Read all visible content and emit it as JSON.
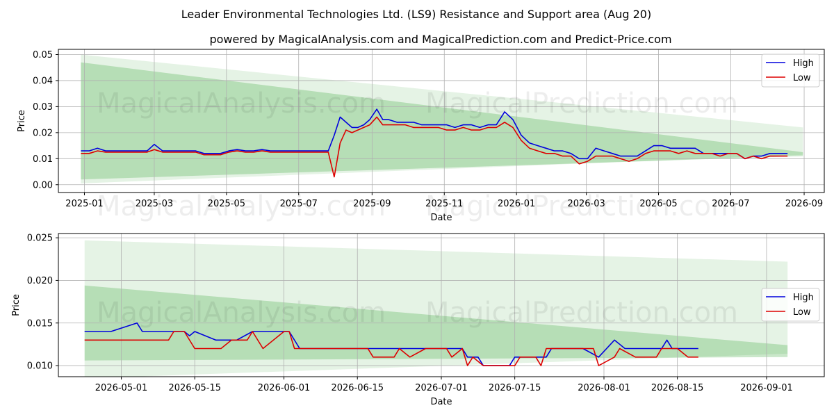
{
  "title": "Leader Environmental Technologies Ltd. (LS9) Resistance and Support area (Aug 20)",
  "subtitle": "powered by MagicalAnalysis.com and MagicalPrediction.com and Predict-Price.com",
  "watermarks": [
    "MagicalAnalysis.com",
    "MagicalPrediction.com"
  ],
  "colors": {
    "high": "#0000dd",
    "low": "#dd0000",
    "band": "#2ca02c"
  },
  "chart_data": [
    {
      "type": "line",
      "xlabel": "Date",
      "ylabel": "Price",
      "x_range": [
        "2024-12-10",
        "2026-09-18"
      ],
      "ylim": [
        -0.003,
        0.052
      ],
      "x_ticks": [
        "2025-01",
        "2025-03",
        "2025-05",
        "2025-07",
        "2025-09",
        "2025-11",
        "2026-01",
        "2026-03",
        "2026-05",
        "2026-07",
        "2026-09"
      ],
      "x_tick_dates": [
        "2025-01-01",
        "2025-03-01",
        "2025-05-01",
        "2025-07-01",
        "2025-09-01",
        "2025-11-01",
        "2026-01-01",
        "2026-03-01",
        "2026-05-01",
        "2026-07-01",
        "2026-09-01"
      ],
      "y_ticks": [
        "0.00",
        "0.01",
        "0.02",
        "0.03",
        "0.04",
        "0.05"
      ],
      "y_tick_values": [
        0,
        0.01,
        0.02,
        0.03,
        0.04,
        0.05
      ],
      "grid": true,
      "legend_position": "top-right",
      "bands": [
        {
          "x": [
            "2024-12-29",
            "2026-08-31"
          ],
          "upper": [
            0.05,
            0.022
          ],
          "lower": [
            0.0005,
            0.0115
          ]
        },
        {
          "x": [
            "2024-12-29",
            "2026-08-31"
          ],
          "upper": [
            0.047,
            0.0125
          ],
          "lower": [
            0.002,
            0.011
          ]
        }
      ],
      "series": [
        {
          "name": "High",
          "x": [
            "2024-12-29",
            "2025-01-05",
            "2025-01-12",
            "2025-01-19",
            "2025-01-26",
            "2025-02-02",
            "2025-02-09",
            "2025-02-16",
            "2025-02-23",
            "2025-03-01",
            "2025-03-08",
            "2025-03-15",
            "2025-03-22",
            "2025-03-29",
            "2025-04-05",
            "2025-04-12",
            "2025-04-19",
            "2025-04-26",
            "2025-05-03",
            "2025-05-10",
            "2025-05-17",
            "2025-05-24",
            "2025-05-31",
            "2025-06-07",
            "2025-06-14",
            "2025-06-21",
            "2025-06-28",
            "2025-07-05",
            "2025-07-12",
            "2025-07-19",
            "2025-07-26",
            "2025-07-31",
            "2025-08-05",
            "2025-08-10",
            "2025-08-15",
            "2025-08-20",
            "2025-08-25",
            "2025-08-30",
            "2025-09-05",
            "2025-09-10",
            "2025-09-15",
            "2025-09-22",
            "2025-09-29",
            "2025-10-06",
            "2025-10-13",
            "2025-10-20",
            "2025-10-27",
            "2025-11-03",
            "2025-11-10",
            "2025-11-17",
            "2025-11-24",
            "2025-12-01",
            "2025-12-08",
            "2025-12-15",
            "2025-12-22",
            "2025-12-29",
            "2026-01-05",
            "2026-01-12",
            "2026-01-19",
            "2026-01-26",
            "2026-02-02",
            "2026-02-09",
            "2026-02-16",
            "2026-02-23",
            "2026-03-02",
            "2026-03-09",
            "2026-03-16",
            "2026-03-23",
            "2026-03-30",
            "2026-04-06",
            "2026-04-13",
            "2026-04-20",
            "2026-04-27",
            "2026-05-04",
            "2026-05-11",
            "2026-05-18",
            "2026-05-25",
            "2026-06-01",
            "2026-06-08",
            "2026-06-15",
            "2026-06-22",
            "2026-06-29",
            "2026-07-06",
            "2026-07-13",
            "2026-07-20",
            "2026-07-27",
            "2026-08-03",
            "2026-08-10",
            "2026-08-18"
          ],
          "values": [
            0.013,
            0.013,
            0.014,
            0.013,
            0.013,
            0.013,
            0.013,
            0.013,
            0.013,
            0.0155,
            0.013,
            0.013,
            0.013,
            0.013,
            0.013,
            0.012,
            0.012,
            0.012,
            0.013,
            0.0135,
            0.013,
            0.013,
            0.0135,
            0.013,
            0.013,
            0.013,
            0.013,
            0.013,
            0.013,
            0.013,
            0.013,
            0.019,
            0.026,
            0.024,
            0.022,
            0.022,
            0.023,
            0.025,
            0.029,
            0.025,
            0.025,
            0.024,
            0.024,
            0.024,
            0.023,
            0.023,
            0.023,
            0.023,
            0.022,
            0.023,
            0.023,
            0.022,
            0.023,
            0.023,
            0.028,
            0.025,
            0.019,
            0.016,
            0.015,
            0.014,
            0.013,
            0.013,
            0.012,
            0.01,
            0.01,
            0.014,
            0.013,
            0.012,
            0.011,
            0.011,
            0.011,
            0.013,
            0.015,
            0.015,
            0.014,
            0.014,
            0.014,
            0.014,
            0.012,
            0.012,
            0.012,
            0.012,
            0.012,
            0.01,
            0.011,
            0.011,
            0.012,
            0.012,
            0.012
          ]
        },
        {
          "name": "Low",
          "x": [
            "2024-12-29",
            "2025-01-05",
            "2025-01-12",
            "2025-01-19",
            "2025-01-26",
            "2025-02-02",
            "2025-02-09",
            "2025-02-16",
            "2025-02-23",
            "2025-03-01",
            "2025-03-08",
            "2025-03-15",
            "2025-03-22",
            "2025-03-29",
            "2025-04-05",
            "2025-04-12",
            "2025-04-19",
            "2025-04-26",
            "2025-05-03",
            "2025-05-10",
            "2025-05-17",
            "2025-05-24",
            "2025-05-31",
            "2025-06-07",
            "2025-06-14",
            "2025-06-21",
            "2025-06-28",
            "2025-07-05",
            "2025-07-12",
            "2025-07-19",
            "2025-07-26",
            "2025-07-31",
            "2025-08-05",
            "2025-08-10",
            "2025-08-15",
            "2025-08-20",
            "2025-08-25",
            "2025-08-30",
            "2025-09-05",
            "2025-09-10",
            "2025-09-15",
            "2025-09-22",
            "2025-09-29",
            "2025-10-06",
            "2025-10-13",
            "2025-10-20",
            "2025-10-27",
            "2025-11-03",
            "2025-11-10",
            "2025-11-17",
            "2025-11-24",
            "2025-12-01",
            "2025-12-08",
            "2025-12-15",
            "2025-12-22",
            "2025-12-29",
            "2026-01-05",
            "2026-01-12",
            "2026-01-19",
            "2026-01-26",
            "2026-02-02",
            "2026-02-09",
            "2026-02-16",
            "2026-02-23",
            "2026-03-02",
            "2026-03-09",
            "2026-03-16",
            "2026-03-23",
            "2026-03-30",
            "2026-04-06",
            "2026-04-13",
            "2026-04-20",
            "2026-04-27",
            "2026-05-04",
            "2026-05-11",
            "2026-05-18",
            "2026-05-25",
            "2026-06-01",
            "2026-06-08",
            "2026-06-15",
            "2026-06-22",
            "2026-06-29",
            "2026-07-06",
            "2026-07-13",
            "2026-07-20",
            "2026-07-27",
            "2026-08-03",
            "2026-08-10",
            "2026-08-18"
          ],
          "values": [
            0.012,
            0.012,
            0.013,
            0.0125,
            0.0125,
            0.0125,
            0.0125,
            0.0125,
            0.0125,
            0.0135,
            0.0125,
            0.0125,
            0.0125,
            0.0125,
            0.0125,
            0.0115,
            0.0115,
            0.0115,
            0.0125,
            0.013,
            0.0125,
            0.0125,
            0.013,
            0.0125,
            0.0125,
            0.0125,
            0.0125,
            0.0125,
            0.0125,
            0.0125,
            0.0125,
            0.003,
            0.016,
            0.021,
            0.02,
            0.021,
            0.022,
            0.023,
            0.026,
            0.023,
            0.023,
            0.023,
            0.023,
            0.022,
            0.022,
            0.022,
            0.022,
            0.021,
            0.021,
            0.022,
            0.021,
            0.021,
            0.022,
            0.022,
            0.024,
            0.022,
            0.017,
            0.014,
            0.013,
            0.012,
            0.012,
            0.011,
            0.011,
            0.008,
            0.009,
            0.011,
            0.011,
            0.011,
            0.01,
            0.009,
            0.01,
            0.012,
            0.013,
            0.013,
            0.013,
            0.012,
            0.013,
            0.012,
            0.012,
            0.012,
            0.011,
            0.012,
            0.012,
            0.01,
            0.011,
            0.01,
            0.011,
            0.011,
            0.011
          ]
        }
      ]
    },
    {
      "type": "line",
      "xlabel": "Date",
      "ylabel": "Price",
      "x_range": [
        "2026-04-19",
        "2026-09-12"
      ],
      "ylim": [
        0.0087,
        0.0255
      ],
      "x_ticks": [
        "2026-05-01",
        "2026-05-15",
        "2026-06-01",
        "2026-06-15",
        "2026-07-01",
        "2026-07-15",
        "2026-08-01",
        "2026-08-15",
        "2026-09-01"
      ],
      "x_tick_dates": [
        "2026-05-01",
        "2026-05-15",
        "2026-06-01",
        "2026-06-15",
        "2026-07-01",
        "2026-07-15",
        "2026-08-01",
        "2026-08-15",
        "2026-09-01"
      ],
      "y_ticks": [
        "0.010",
        "0.015",
        "0.020",
        "0.025"
      ],
      "y_tick_values": [
        0.01,
        0.015,
        0.02,
        0.025
      ],
      "grid": true,
      "legend_position": "center-right",
      "bands": [
        {
          "x": [
            "2026-04-24",
            "2026-09-05"
          ],
          "upper": [
            0.0247,
            0.0222
          ],
          "lower": [
            0.0085,
            0.0114
          ]
        },
        {
          "x": [
            "2026-04-24",
            "2026-09-05"
          ],
          "upper": [
            0.0194,
            0.0124
          ],
          "lower": [
            0.0106,
            0.011
          ]
        }
      ],
      "series": [
        {
          "name": "High",
          "x": [
            "2026-04-24",
            "2026-04-29",
            "2026-05-04",
            "2026-05-05",
            "2026-05-10",
            "2026-05-12",
            "2026-05-13",
            "2026-05-14",
            "2026-05-15",
            "2026-05-19",
            "2026-05-23",
            "2026-05-26",
            "2026-05-31",
            "2026-06-02",
            "2026-06-04",
            "2026-06-08",
            "2026-06-16",
            "2026-06-20",
            "2026-06-28",
            "2026-07-03",
            "2026-07-05",
            "2026-07-06",
            "2026-07-08",
            "2026-07-09",
            "2026-07-12",
            "2026-07-14",
            "2026-07-15",
            "2026-07-21",
            "2026-07-22",
            "2026-07-28",
            "2026-07-31",
            "2026-08-03",
            "2026-08-05",
            "2026-08-12",
            "2026-08-13",
            "2026-08-14",
            "2026-08-19"
          ],
          "values": [
            0.014,
            0.014,
            0.015,
            0.014,
            0.014,
            0.014,
            0.014,
            0.0135,
            0.014,
            0.013,
            0.013,
            0.014,
            0.014,
            0.014,
            0.012,
            0.012,
            0.012,
            0.012,
            0.012,
            0.012,
            0.012,
            0.011,
            0.011,
            0.01,
            0.01,
            0.01,
            0.011,
            0.011,
            0.012,
            0.012,
            0.011,
            0.013,
            0.012,
            0.012,
            0.013,
            0.012,
            0.012
          ]
        },
        {
          "name": "Low",
          "x": [
            "2026-04-24",
            "2026-05-04",
            "2026-05-10",
            "2026-05-11",
            "2026-05-13",
            "2026-05-15",
            "2026-05-20",
            "2026-05-22",
            "2026-05-25",
            "2026-05-26",
            "2026-05-28",
            "2026-06-01",
            "2026-06-02",
            "2026-06-03",
            "2026-06-11",
            "2026-06-17",
            "2026-06-18",
            "2026-06-22",
            "2026-06-23",
            "2026-06-25",
            "2026-06-28",
            "2026-07-02",
            "2026-07-03",
            "2026-07-05",
            "2026-07-06",
            "2026-07-07",
            "2026-07-09",
            "2026-07-15",
            "2026-07-16",
            "2026-07-19",
            "2026-07-20",
            "2026-07-21",
            "2026-07-30",
            "2026-07-31",
            "2026-08-03",
            "2026-08-04",
            "2026-08-07",
            "2026-08-11",
            "2026-08-12",
            "2026-08-15",
            "2026-08-17",
            "2026-08-19"
          ],
          "values": [
            0.013,
            0.013,
            0.013,
            0.014,
            0.014,
            0.012,
            0.012,
            0.013,
            0.013,
            0.014,
            0.012,
            0.014,
            0.014,
            0.012,
            0.012,
            0.012,
            0.011,
            0.011,
            0.012,
            0.011,
            0.012,
            0.012,
            0.011,
            0.012,
            0.01,
            0.011,
            0.01,
            0.01,
            0.011,
            0.011,
            0.01,
            0.012,
            0.012,
            0.01,
            0.011,
            0.012,
            0.011,
            0.011,
            0.012,
            0.012,
            0.011,
            0.011
          ]
        }
      ]
    }
  ]
}
